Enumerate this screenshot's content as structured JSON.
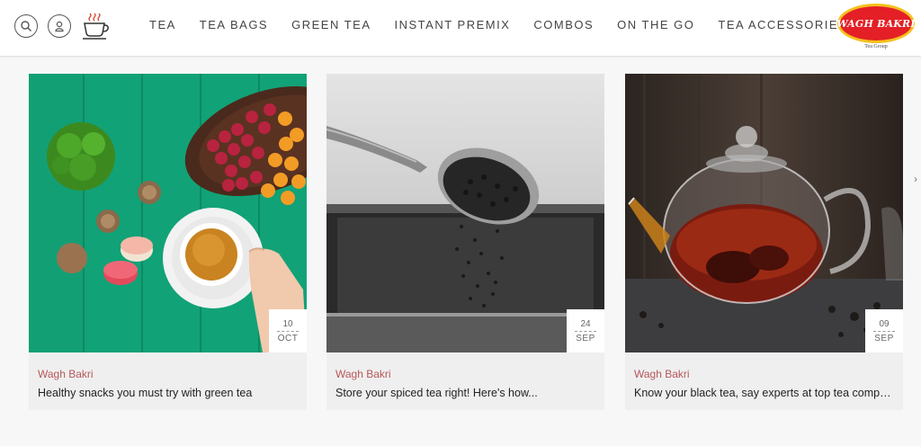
{
  "header": {
    "icons": [
      "search-icon",
      "user-icon",
      "tea-cup-icon"
    ],
    "nav": [
      "TEA",
      "TEA BAGS",
      "GREEN TEA",
      "INSTANT PREMIX",
      "COMBOS",
      "ON THE GO",
      "TEA ACCESSORIES"
    ],
    "logo": {
      "brand": "WAGH BAKRI",
      "sub": "Tea Group"
    }
  },
  "cards": [
    {
      "author": "Wagh Bakri",
      "title": "Healthy snacks you must try with green tea",
      "day": "10",
      "month": "OCT"
    },
    {
      "author": "Wagh Bakri",
      "title": "Store your spiced tea right! Here's how...",
      "day": "24",
      "month": "SEP"
    },
    {
      "author": "Wagh Bakri",
      "title": "Know your black tea, say experts at top tea compa...",
      "day": "09",
      "month": "SEP"
    }
  ],
  "colors": {
    "accent": "#b5575a",
    "logo_red": "#e41f26",
    "logo_yellow": "#f6c01e"
  }
}
